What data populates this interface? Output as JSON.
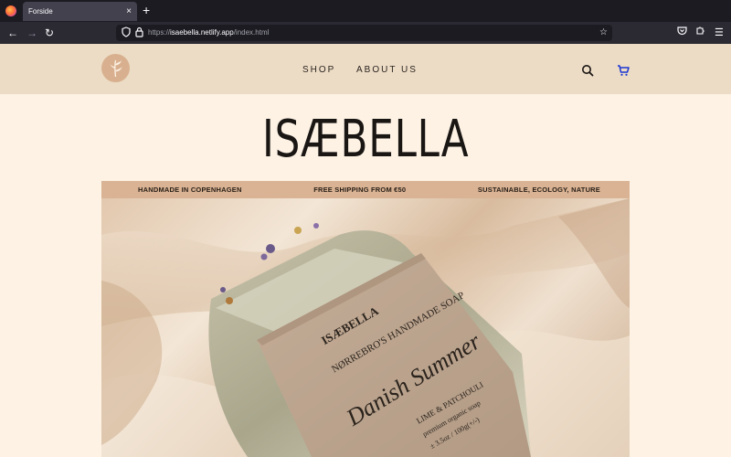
{
  "browser": {
    "tab_title": "Forside",
    "tab_close": "×",
    "new_tab": "+",
    "url_prefix": "https://",
    "url_domain": "isaebella.netlify.app",
    "url_path": "/index.html",
    "icons": [
      "back-icon",
      "forward-icon",
      "reload-icon",
      "shield-icon",
      "lock-icon",
      "bookmark-star-icon",
      "pocket-icon",
      "extensions-icon",
      "menu-icon"
    ]
  },
  "header": {
    "nav": [
      {
        "label": "SHOP"
      },
      {
        "label": "ABOUT US"
      }
    ],
    "icons": [
      "logo-leaf-icon",
      "search-icon",
      "cart-icon"
    ],
    "cart_color": "#1a35d4"
  },
  "hero": {
    "brand": "ISÆBELLA",
    "info": [
      "HANDMADE IN COPENHAGEN",
      "FREE SHIPPING FROM €50",
      "SUSTAINABLE, ECOLOGY, NATURE"
    ],
    "label": {
      "brand": "ISÆBELLA",
      "subtitle": "NØRREBRO'S HANDMADE SOAP",
      "script_name": "Danish Summer",
      "scent": "LIME & PATCHOULI",
      "description": "premium organic soap",
      "weight": "± 3.5oz / 100g(+/-)"
    }
  },
  "colors": {
    "page_bg": "#fdf2e4",
    "header_bg": "#ecdcc5",
    "info_bar_bg": "#d9b394",
    "logo_bg": "#d8b08f"
  }
}
